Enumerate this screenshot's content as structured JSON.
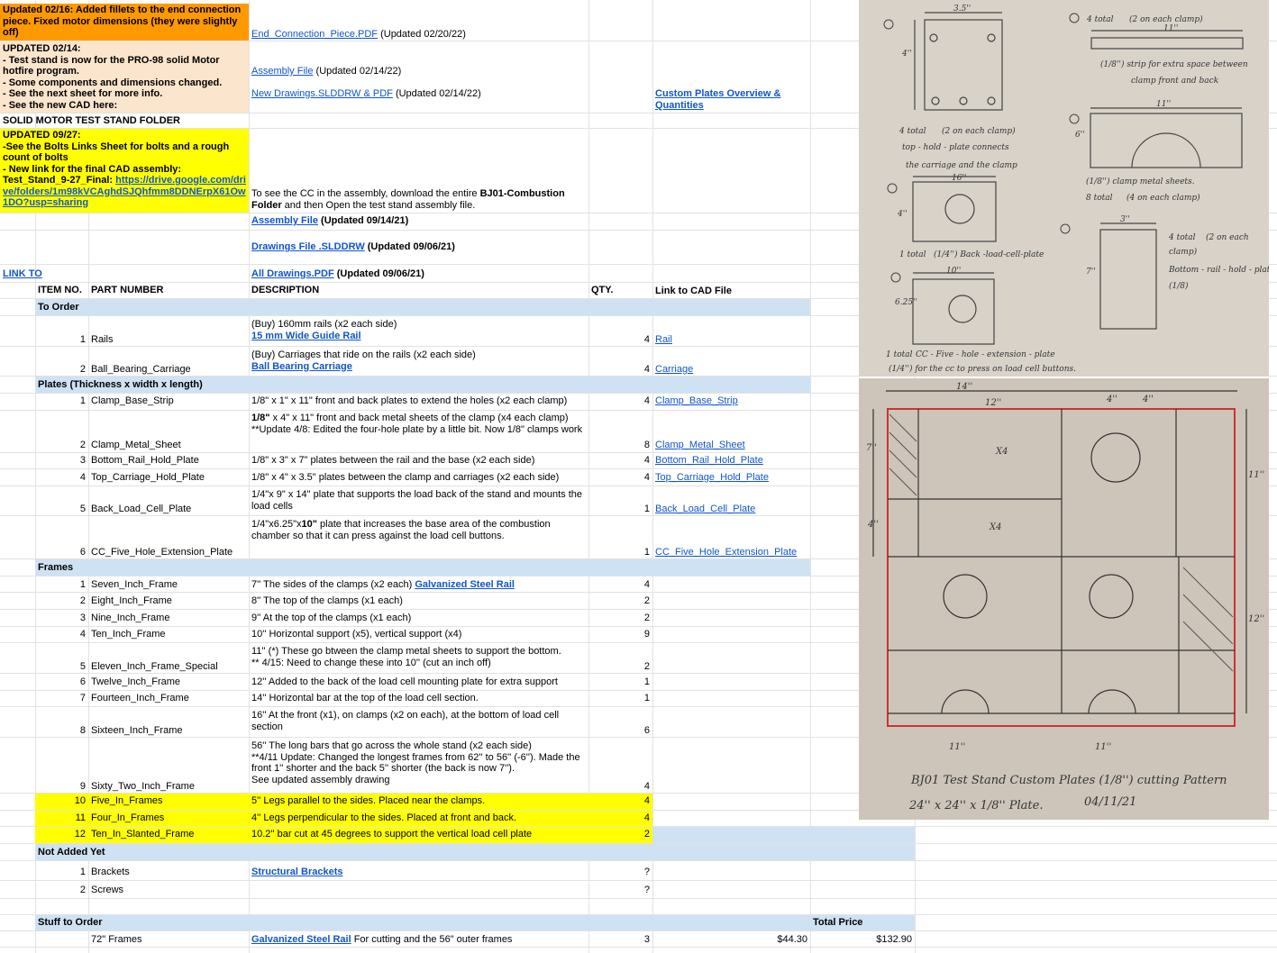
{
  "colors": {
    "orange": "#ff9900",
    "peach": "#fce5cd",
    "yellow": "#ffff00",
    "section_blue": "#cfe2f3",
    "link": "#1155cc"
  },
  "notes": {
    "update_0216": "Updated 02/16: Added fillets to the end connection piece. Fixed motor dimensions (they were slightly off)",
    "end_conn_link": "End_Connection_Piece.PDF",
    "end_conn_date": " (Updated 02/20/22)",
    "update_0214": [
      "UPDATED 02/14:",
      "- Test stand is now for the PRO-98 solid Motor hotfire program.",
      "- Some components and dimensions changed.",
      "- See the next sheet for more info.",
      "- See the new CAD here:"
    ],
    "assembly_link_0214": "Assembly File",
    "assembly_date_0214": " (Updated 02/14/22)",
    "new_drawings_link": "New Drawings.SLDDRW & PDF",
    "new_drawings_date": " (Updated 02/14/22)",
    "custom_plates_link": "Custom Plates Overview & Quantities",
    "folder_title": "SOLID MOTOR TEST STAND FOLDER",
    "update_0927_text": "UPDATED 09/27:\n-See the Bolts Links Sheet for bolts and a rough count of bolts\n- New link for the final CAD assembly:\nTest_Stand_9-27_Final: ",
    "update_0927_url": "https://drive.google.com/drive/folders/1m98kVCAghdSJQhfmm8DDNErpX61Ow1DO?usp=sharing",
    "cc_note_1": "To see the CC in the assembly, download the entire ",
    "cc_note_bold": "BJ01-Combustion Folder",
    "cc_note_2": " and then Open the test stand assembly file.",
    "assembly_link": "Assembly File",
    "assembly_date": " (Updated 09/14/21)",
    "drawings_link": "Drawings File .SLDDRW",
    "drawings_date": " (Updated 09/06/21)",
    "folder_link": "LINK TO FOLDER",
    "all_drawings_link": "All Drawings.PDF",
    "all_drawings_date": "  (Updated 09/06/21)"
  },
  "headers": {
    "item": "ITEM NO.",
    "part": "PART NUMBER",
    "desc": "DESCRIPTION",
    "qty": "QTY.",
    "cad": "Link to CAD File"
  },
  "sections": {
    "to_order": "To Order",
    "plates": "Plates (Thickness x width x length)",
    "frames": "Frames",
    "not_added": "Not Added Yet",
    "stuff": "Stuff to Order",
    "total_price": "Total Price"
  },
  "rows": {
    "rails": {
      "no": "1",
      "part": "Rails",
      "desc1": "(Buy) 160mm rails (x2 each side)",
      "desc_link": "15 mm Wide Guide Rail",
      "qty": "4",
      "cad": "Rail"
    },
    "carriage": {
      "no": "2",
      "part": "Ball_Bearing_Carriage",
      "desc1": "(Buy) Carriages that ride on the rails (x2 each side)",
      "desc_link": "Ball Bearing Carriage",
      "qty": "4",
      "cad": "Carriage"
    },
    "p1": {
      "no": "1",
      "part": "Clamp_Base_Strip",
      "desc": "1/8\" x 1\" x 11\" front and back plates to extend the holes (x2 each clamp)",
      "qty": "4",
      "cad": "Clamp_Base_Strip"
    },
    "p2": {
      "no": "2",
      "part": "Clamp_Metal_Sheet",
      "desc_bold": "1/8\"",
      "desc": " x 4\" x 11\" front and back metal sheets of the clamp (x4 each clamp)\n**Update 4/8: Edited the four-hole plate by a little bit. Now 1/8\" clamps work",
      "qty": "8",
      "cad": "Clamp_Metal_Sheet"
    },
    "p3": {
      "no": "3",
      "part": "Bottom_Rail_Hold_Plate",
      "desc": "1/8\" x 3\" x 7\" plates between the rail and the base (x2 each side)",
      "qty": "4",
      "cad": "Bottom_Rail_Hold_Plate"
    },
    "p4": {
      "no": "4",
      "part": "Top_Carriage_Hold_Plate",
      "desc": "1/8\" x  4\" x 3.5\" plates between the clamp and carriages (x2 each side)",
      "qty": "4",
      "cad": "Top_Carriage_Hold_Plate"
    },
    "p5": {
      "no": "5",
      "part": "Back_Load_Cell_Plate",
      "desc": "1/4\"x 9\" x 14\" plate that supports the load back of the stand and mounts the load cells",
      "qty": "1",
      "cad": "Back_Load_Cell_Plate"
    },
    "p6": {
      "no": "6",
      "part": "CC_Five_Hole_Extension_Plate",
      "desc_a": "1/4\"x6.25\"x",
      "desc_bold": "10\"",
      "desc_b": " plate that increases the base area of the combustion chamber so that it can press against the load cell buttons.",
      "qty": "1",
      "cad": "CC_Five_Hole_Extension_Plate"
    },
    "f1": {
      "no": "1",
      "part": "Seven_Inch_Frame",
      "desc": "7'' The sides of the clamps (x2 each) ",
      "desc_link": "Galvanized Steel Rail",
      "qty": "4"
    },
    "f2": {
      "no": "2",
      "part": "Eight_Inch_Frame",
      "desc": "8'' The top of the clamps (x1 each)",
      "qty": "2"
    },
    "f3": {
      "no": "3",
      "part": "Nine_Inch_Frame",
      "desc": "9'' At the top of the clamps (x1 each)",
      "qty": "2"
    },
    "f4": {
      "no": "4",
      "part": "Ten_Inch_Frame",
      "desc": "10'' Horizontal support (x5), vertical support (x4)",
      "qty": "9"
    },
    "f5": {
      "no": "5",
      "part": "Eleven_Inch_Frame_Special",
      "desc": "11'' (*) These go btween the clamp metal sheets to support the bottom.\n** 4/15: Need to change these into 10'' (cut an inch off)",
      "qty": "2"
    },
    "f6": {
      "no": "6",
      "part": "Twelve_Inch_Frame",
      "desc": "12'' Added to the back of the load cell mounting plate for extra support",
      "qty": "1"
    },
    "f7": {
      "no": "7",
      "part": "Fourteen_Inch_Frame",
      "desc": "14'' Horizontal bar at the top of the load cell section.",
      "qty": "1"
    },
    "f8": {
      "no": "8",
      "part": "Sixteen_Inch_Frame",
      "desc": "16'' At the front (x1), on clamps (x2 on each), at the bottom of load cell section",
      "qty": "6"
    },
    "f9": {
      "no": "9",
      "part": "Sixty_Two_Inch_Frame",
      "desc": "56'' The long bars that go across the whole stand (x2 each side)\n**4/11 Update: Changed the longest frames from 62'' to 56'' (-6''). Made the front 1'' shorter and the back 5'' shorter (the back is now 7'').\nSee updated assembly drawing",
      "qty": "4"
    },
    "f10": {
      "no": "10",
      "part": "Five_In_Frames",
      "desc": "5'' Legs parallel to the sides. Placed near the clamps.",
      "qty": "4"
    },
    "f11": {
      "no": "11",
      "part": "Four_In_Frames",
      "desc": "4'' Legs perpendicular to the sides. Placed at front and back.",
      "qty": "4"
    },
    "f12": {
      "no": "12",
      "part": "Ten_In_Slanted_Frame",
      "desc": "10.2'' bar cut at 45 degrees to support the vertical load cell plate",
      "qty": "2"
    },
    "n1": {
      "no": "1",
      "part": "Brackets",
      "desc_link": "Structural Brackets",
      "qty": "?"
    },
    "n2": {
      "no": "2",
      "part": "Screws",
      "qty": "?"
    },
    "s1": {
      "part": "72\" Frames",
      "desc_link": "Galvanized Steel Rail",
      "desc": " For cutting and the 56\" outer frames",
      "qty": "3",
      "unit": "$44.30",
      "total": "$132.90"
    }
  },
  "sketch_top": {
    "labels": [
      "3.5''",
      "4''",
      "4 total",
      "(2 on each clamp)",
      "top - hold - plate connects",
      "the carriage and the clamp",
      "16''",
      "4''",
      "1 total",
      "(1/4'') Back -load-cell-plate",
      "10''",
      "6.25''",
      "1 total",
      "CC - Five - hole - extension - plate",
      "(1/4'') for the cc to press on load cell buttons.",
      "4 total",
      "(2 on each clamp)",
      "11''",
      "(1/8'') strip for extra space between",
      "clamp front and back",
      "11''",
      "6''",
      "(1/8'') clamp metal sheets.",
      "8 total",
      "(4 on each clamp)",
      "3''",
      "7''",
      "4 total",
      "(2 on each",
      "clamp)",
      "Bottom - rail - hold - plate",
      "(1/8)"
    ]
  },
  "sketch_bottom": {
    "labels": [
      "14''",
      "12''",
      "4''",
      "4''",
      "7''",
      "X4",
      "X4",
      "11''",
      "4''",
      "12''",
      "11''",
      "11''",
      "BJ01 Test Stand Custom Plates (1/8'') cutting Pattern",
      "24'' x 24'' x 1/8'' Plate.",
      "04/11/21"
    ]
  }
}
